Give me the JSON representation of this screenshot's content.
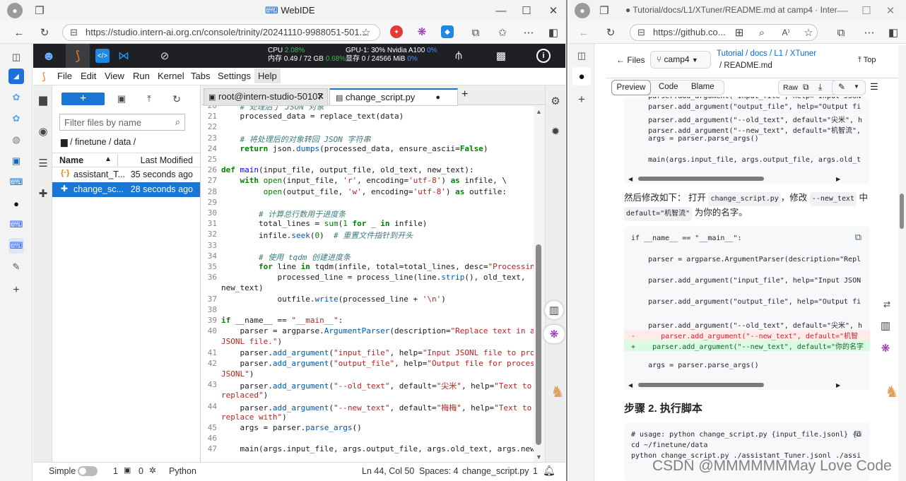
{
  "left_browser": {
    "window_title": "WebIDE",
    "url": "https://studio.intern-ai.org.cn/console/trinity/20241110-9988051-501..."
  },
  "jupyter_top": {
    "cpu_label": "CPU",
    "cpu_value": "2.08%",
    "mem_label": "内存 0.49 / 72 GB",
    "mem_value": "0.68%",
    "gpu_label": "GPU-1: 30% Nvidia A100",
    "gpu_value": "0%",
    "vram_label": "显存 0 / 24566 MiB",
    "vram_value": "0%"
  },
  "menu": [
    "File",
    "Edit",
    "View",
    "Run",
    "Kernel",
    "Tabs",
    "Settings",
    "Help"
  ],
  "file_browser": {
    "new_button": "+",
    "filter_placeholder": "Filter files by name",
    "path": "/ finetune / data /",
    "col_name": "Name",
    "col_modified": "Last Modified",
    "files": [
      {
        "name": "assistant_T...",
        "modified": "35 seconds ago"
      },
      {
        "name": "change_sc...",
        "modified": "28 seconds ago"
      }
    ]
  },
  "tabs": {
    "terminal": "root@intern-studio-50107",
    "editor": "change_script.py",
    "add": "+"
  },
  "code_lines": [
    {
      "n": "20",
      "html": "    <span class=\"cm\"># 处理后了 JSON 对象</span>"
    },
    {
      "n": "21",
      "html": "    processed_data = replace_text(data)"
    },
    {
      "n": "22",
      "html": ""
    },
    {
      "n": "23",
      "html": "    <span class=\"cm\"># 将处理后的对象转回 JSON 字符串</span>"
    },
    {
      "n": "24",
      "html": "    <span class=\"kw\">return</span> json.<span class=\"at\">dumps</span>(processed_data, ensure_ascii=<span class=\"kw\">False</span>)"
    },
    {
      "n": "25",
      "html": ""
    },
    {
      "n": "26",
      "html": "<span class=\"kw\">def</span> <span class=\"fn\">main</span>(input_file, output_file, old_text, new_text):"
    },
    {
      "n": "27",
      "html": "    <span class=\"kw\">with</span> <span class=\"bi\">open</span>(input_file, <span class=\"st\">'r'</span>, encoding=<span class=\"st\">'utf-8'</span>) <span class=\"kw\">as</span> infile, \\"
    },
    {
      "n": "28",
      "html": "         <span class=\"bi\">open</span>(output_file, <span class=\"st\">'w'</span>, encoding=<span class=\"st\">'utf-8'</span>) <span class=\"kw\">as</span> outfile:"
    },
    {
      "n": "29",
      "html": ""
    },
    {
      "n": "30",
      "html": "        <span class=\"cm\"># 计算总行数用于进度条</span>"
    },
    {
      "n": "31",
      "html": "        total_lines = <span class=\"bi\">sum</span>(<span class=\"nm\">1</span> <span class=\"kw\">for</span> _ <span class=\"kw\">in</span> infile)"
    },
    {
      "n": "32",
      "html": "        infile.<span class=\"at\">seek</span>(<span class=\"nm\">0</span>)  <span class=\"cm\"># 重置文件指针到开头</span>"
    },
    {
      "n": "33",
      "html": ""
    },
    {
      "n": "34",
      "html": "        <span class=\"cm\"># 使用 tqdm 创建进度条</span>"
    },
    {
      "n": "35",
      "html": "        <span class=\"kw\">for</span> line <span class=\"kw\">in</span> tqdm(infile, total=total_lines, desc=<span class=\"st\">\"Processing\"</span>):"
    },
    {
      "n": "36",
      "html": "            processed_line = process_line(line.<span class=\"at\">strip</span>(), old_text,"
    },
    {
      "n": "",
      "html": "new_text)"
    },
    {
      "n": "37",
      "html": "            outfile.<span class=\"at\">write</span>(processed_line + <span class=\"st\">'\\n'</span>)"
    },
    {
      "n": "38",
      "html": ""
    },
    {
      "n": "39",
      "html": "<span class=\"kw\">if</span> __name__ == <span class=\"st\">\"__main__\"</span>:"
    },
    {
      "n": "40",
      "html": "    parser = argparse.<span class=\"at\">ArgumentParser</span>(description=<span class=\"st\">\"Replace text in a</span>"
    },
    {
      "n": "",
      "html": "<span class=\"st\">JSONL file.\"</span>)"
    },
    {
      "n": "41",
      "html": "    parser.<span class=\"at\">add_argument</span>(<span class=\"st\">\"input_file\"</span>, help=<span class=\"st\">\"Input JSONL file to process\"</span>)"
    },
    {
      "n": "42",
      "html": "    parser.<span class=\"at\">add_argument</span>(<span class=\"st\">\"output_file\"</span>, help=<span class=\"st\">\"Output file for processed</span>"
    },
    {
      "n": "",
      "html": "<span class=\"st\">JSONL\"</span>)"
    },
    {
      "n": "43",
      "html": "    parser.<span class=\"at\">add_argument</span>(<span class=\"st\">\"--old_text\"</span>, default=<span class=\"st\">\"尖米\"</span>, help=<span class=\"st\">\"Text to be</span>"
    },
    {
      "n": "",
      "html": "<span class=\"st\">replaced\"</span>)"
    },
    {
      "n": "44",
      "html": "    parser.<span class=\"at\">add_argument</span>(<span class=\"st\">\"--new_text\"</span>, default=<span class=\"st\">\"梅梅\"</span>, help=<span class=\"st\">\"Text to</span>"
    },
    {
      "n": "",
      "html": "<span class=\"st\">replace with\"</span>)"
    },
    {
      "n": "45",
      "html": "    args = parser.<span class=\"at\">parse_args</span>()"
    },
    {
      "n": "46",
      "html": ""
    },
    {
      "n": "47",
      "html": "    main(args.input_file, args.output_file, args.old_text, args.new_text)"
    }
  ],
  "status": {
    "mode": "Simple",
    "count1": "1",
    "count2": "0",
    "kernel": "Python",
    "position": "Ln 44, Col 50",
    "spaces": "Spaces: 4",
    "file": "change_script.py",
    "notif": "1"
  },
  "right_browser": {
    "window_title": "Tutorial/docs/L1/XTuner/README.md at camp4 · Intern...",
    "url": "https://github.co..."
  },
  "github": {
    "files_label": "Files",
    "branch": "camp4",
    "breadcrumb": [
      "Tutorial",
      "docs",
      "L1",
      "XTuner"
    ],
    "filename": "/ README.md",
    "top_label": "Top",
    "view_tabs": [
      "Preview",
      "Code",
      "Blame"
    ],
    "raw_label": "Raw",
    "block1_lines": [
      "    parser.add_argument(\"input_file\", help=\"Input JSON",
      "    parser.add_argument(\"output_file\", help=\"Output fi",
      "    parser.add_argument(\"--old_text\", default=\"尖米\", h",
      "    parser.add_argument(\"--new_text\", default=\"机智流\",",
      "    args = parser.parse_args()",
      "",
      "    main(args.input_file, args.output_file, args.old_t"
    ],
    "para_prefix": "然后修改如下： 打开",
    "para_code1": "change_script.py",
    "para_mid": "，修改",
    "para_code2": "--new_text",
    "para_mid2": "中",
    "para_code3": "default=\"机智流\"",
    "para_suffix": "为你的名字。",
    "block2_lines": [
      "if __name__ == \"__main__\":",
      "",
      "    parser = argparse.ArgumentParser(description=\"Repl",
      "",
      "    parser.add_argument(\"input_file\", help=\"Input JSON",
      "",
      "    parser.add_argument(\"output_file\", help=\"Output fi",
      "",
      "    parser.add_argument(\"--old_text\", default=\"尖米\", h",
      "-      parser.add_argument(\"--new_text\", default=\"机智",
      "+    parser.add_argument(\"--new_text\", default=\"你的名字",
      "",
      "    args = parser.parse_args()"
    ],
    "step_heading": "步骤 2. 执行脚本",
    "block3_lines": [
      "# usage: python change_script.py {input_file.jsonl} {o",
      "cd ~/finetune/data",
      "python change_script.py ./assistant_Tuner.jsonl ./assi"
    ],
    "watermark": "CSDN @MMMMMMMay Love Code"
  },
  "colors": {
    "accent_blue": "#1976d2",
    "jupyter_dark": "#1f2023",
    "cpu_green": "#3fb950",
    "gpu_blue": "#4a8cff",
    "gh_link": "#0969da"
  }
}
